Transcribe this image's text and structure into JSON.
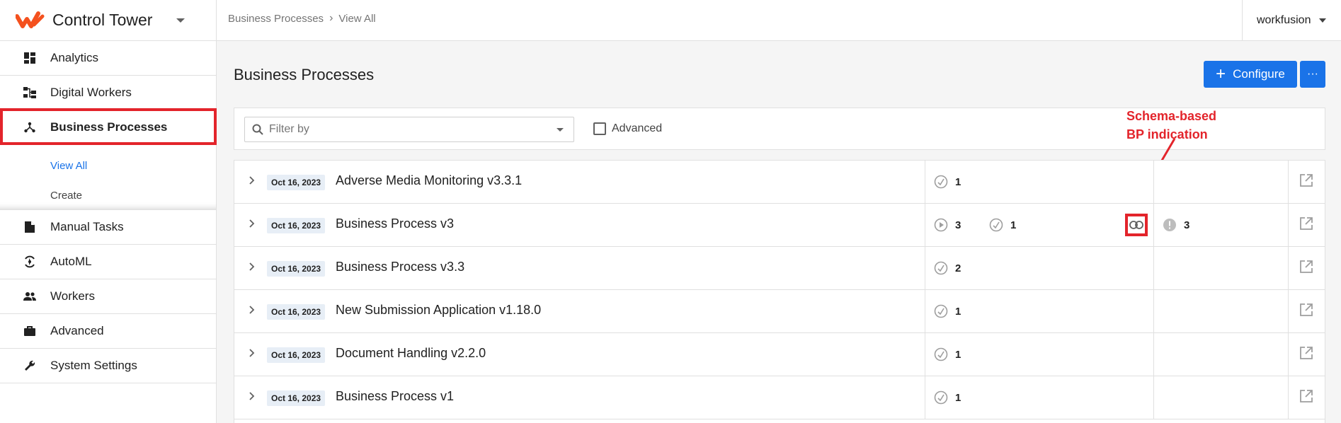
{
  "app": {
    "title": "Control Tower"
  },
  "sidebar": {
    "items": [
      {
        "label": "Analytics",
        "icon": "dashboard-icon"
      },
      {
        "label": "Digital Workers",
        "icon": "hierarchy-icon"
      },
      {
        "label": "Business Processes",
        "icon": "process-icon",
        "active": true
      },
      {
        "label": "Manual Tasks",
        "icon": "document-icon"
      },
      {
        "label": "AutoML",
        "icon": "automl-icon"
      },
      {
        "label": "Workers",
        "icon": "people-icon"
      },
      {
        "label": "Advanced",
        "icon": "briefcase-icon"
      },
      {
        "label": "System Settings",
        "icon": "wrench-icon"
      }
    ],
    "sub_items": [
      {
        "label": "View All",
        "current": true
      },
      {
        "label": "Create"
      }
    ]
  },
  "breadcrumb": {
    "parent": "Business Processes",
    "current": "View All"
  },
  "user": {
    "name": "workfusion"
  },
  "main": {
    "title": "Business Processes",
    "configure_label": "Configure",
    "more_label": "···"
  },
  "filter": {
    "placeholder": "Filter by",
    "advanced_label": "Advanced"
  },
  "annotation": {
    "line1": "Schema-based",
    "line2": "BP indication"
  },
  "processes": [
    {
      "date": "Oct 16, 2023",
      "name": "Adverse Media Monitoring v3.3.1",
      "count1": "1"
    },
    {
      "date": "Oct 16, 2023",
      "name": "Business Process  v3",
      "count1": "3",
      "count2": "1",
      "count3": "3"
    },
    {
      "date": "Oct 16, 2023",
      "name": "Business Process v3.3",
      "count1": "2"
    },
    {
      "date": "Oct 16, 2023",
      "name": "New Submission Application v1.18.0",
      "count1": "1"
    },
    {
      "date": "Oct 16, 2023",
      "name": "Document Handling v2.2.0",
      "count1": "1"
    },
    {
      "date": "Oct 16, 2023",
      "name": "Business Process  v1",
      "count1": "1"
    }
  ],
  "colors": {
    "accent": "#1a73e8",
    "highlight": "#e3242b",
    "brand": "#f4511e"
  }
}
